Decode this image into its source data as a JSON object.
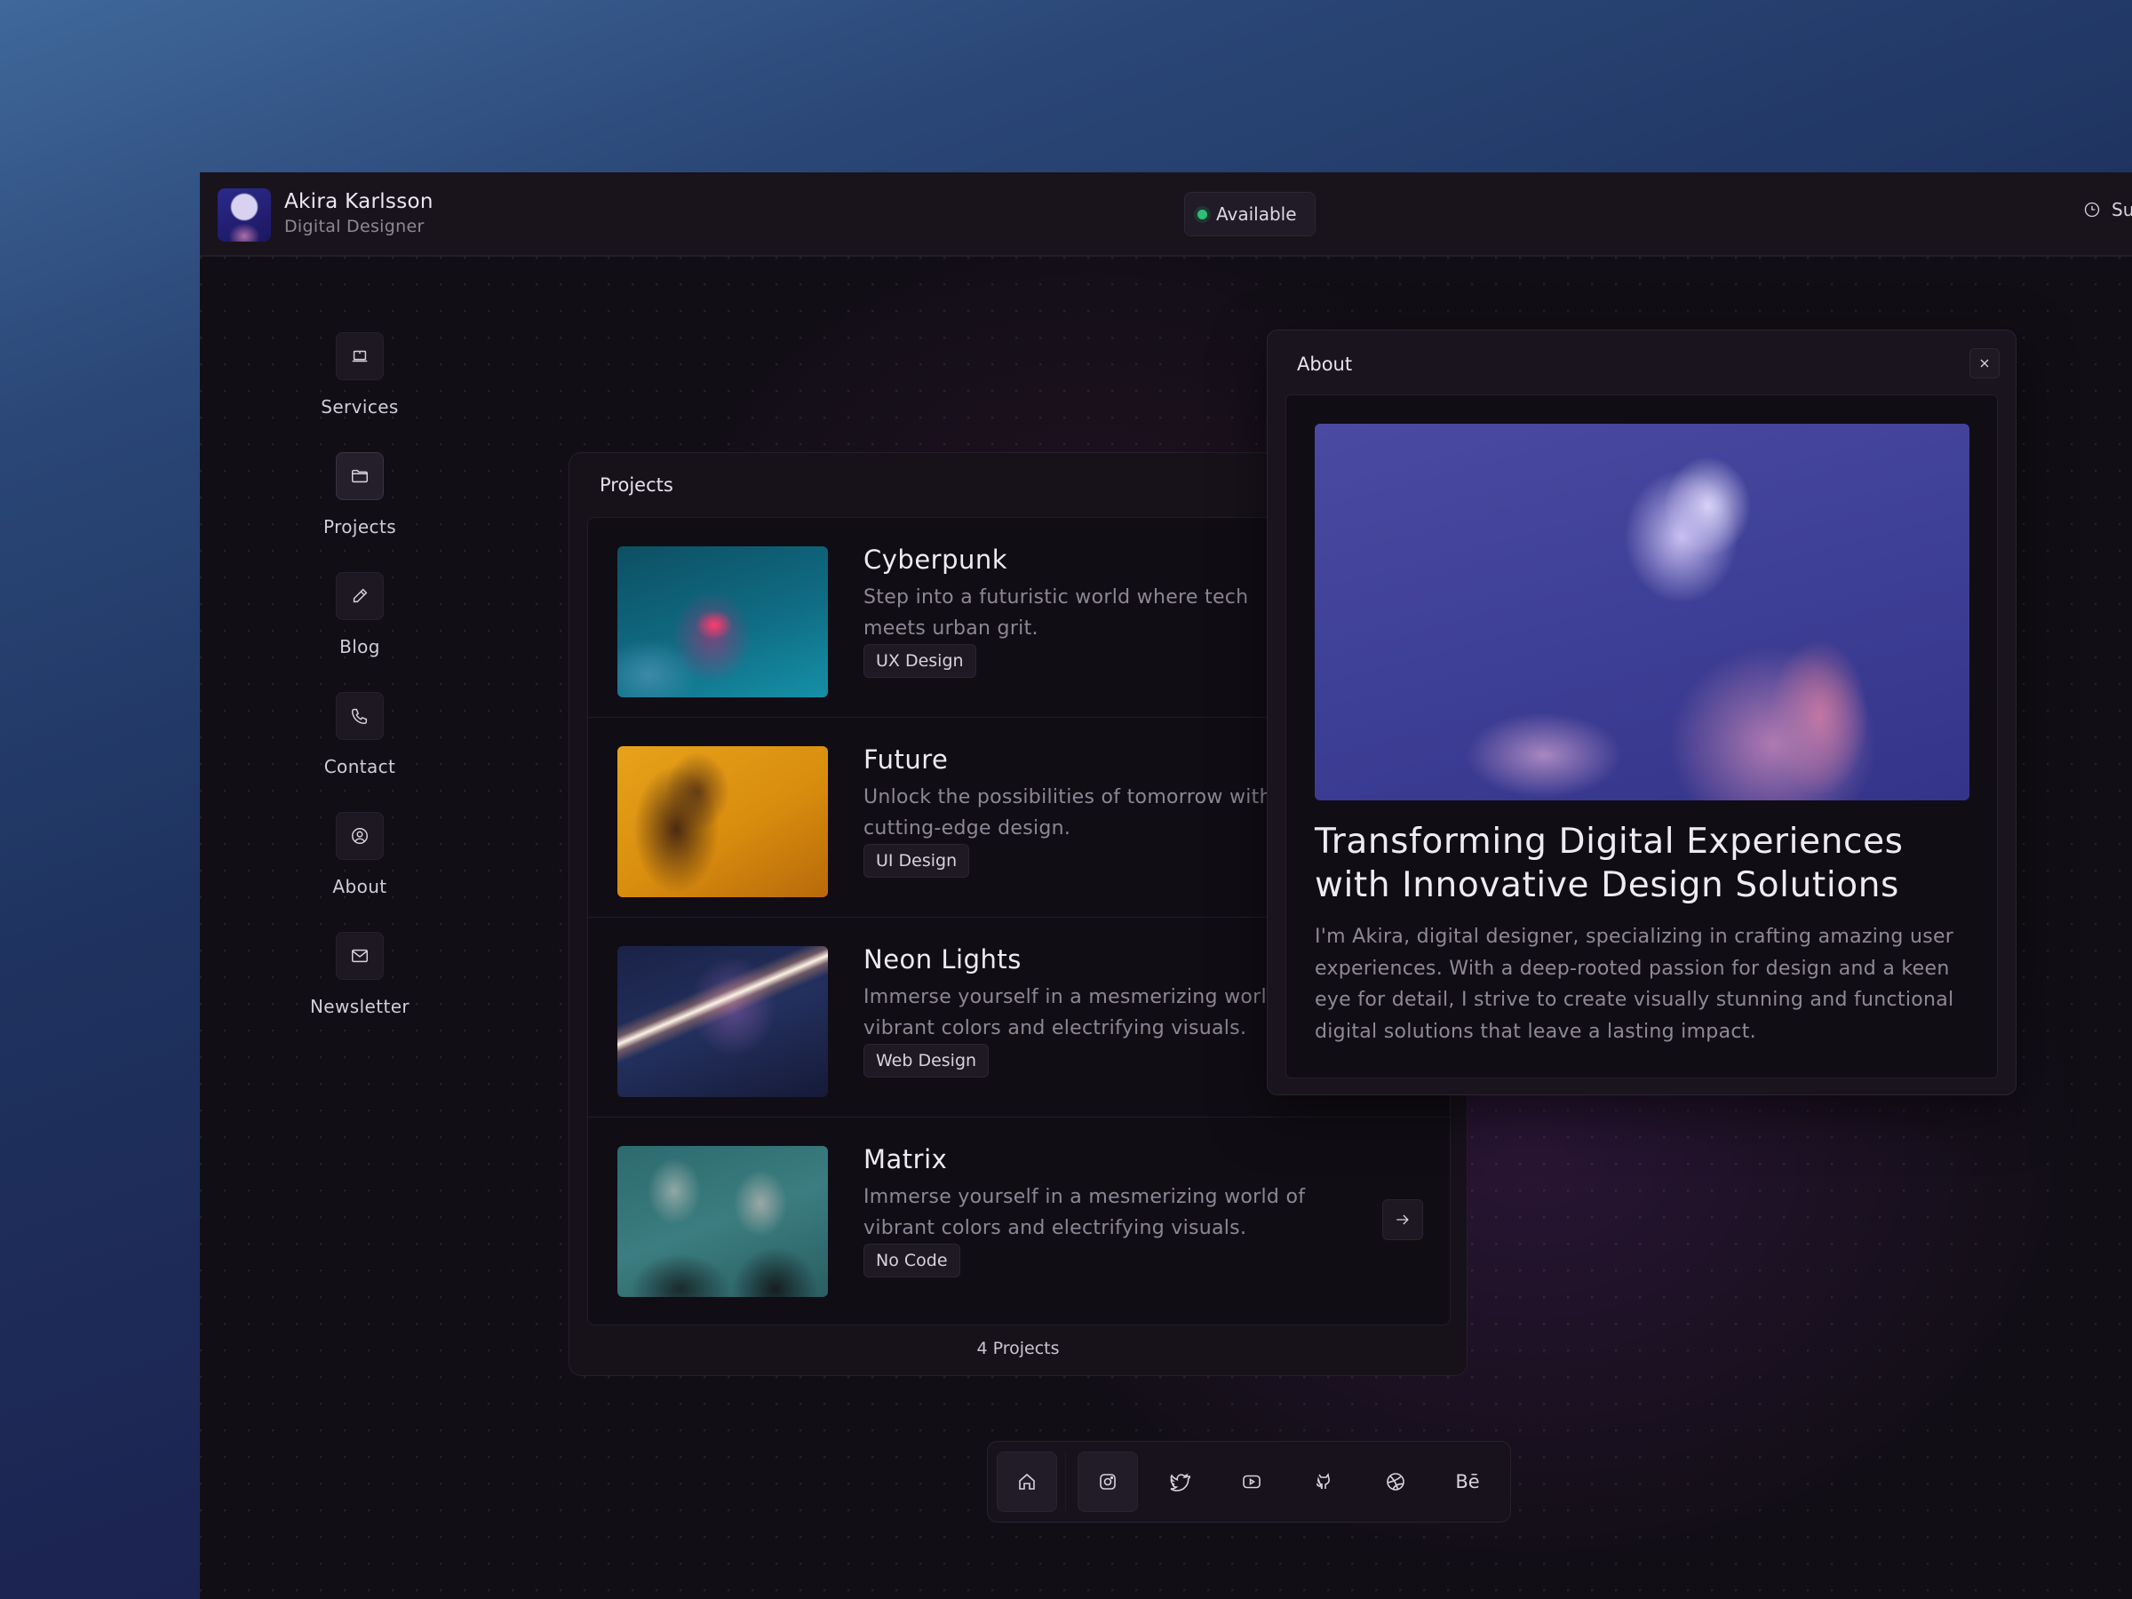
{
  "header": {
    "profile_name": "Akira Karlsson",
    "profile_role": "Digital Designer",
    "status_label": "Available",
    "status_color": "#2dbf73",
    "clock_text": "Su"
  },
  "sidebar": {
    "items": [
      {
        "label": "Services",
        "icon": "laptop-icon"
      },
      {
        "label": "Projects",
        "icon": "folder-icon",
        "active": true
      },
      {
        "label": "Blog",
        "icon": "pencil-icon"
      },
      {
        "label": "Contact",
        "icon": "phone-icon"
      },
      {
        "label": "About",
        "icon": "user-circle-icon"
      },
      {
        "label": "Newsletter",
        "icon": "mail-icon"
      }
    ]
  },
  "projects": {
    "title": "Projects",
    "count_label": "4 Projects",
    "items": [
      {
        "name": "Cyberpunk",
        "description": "Step into a futuristic world where tech\nmeets urban grit.",
        "tag": "UX Design"
      },
      {
        "name": "Future",
        "description": "Unlock the possibilities of tomorrow with\ncutting-edge design.",
        "tag": "UI Design"
      },
      {
        "name": "Neon Lights",
        "description": "Immerse yourself in a mesmerizing world of\nvibrant colors and electrifying visuals.",
        "tag": "Web Design"
      },
      {
        "name": "Matrix",
        "description": "Immerse yourself in a mesmerizing world of\nvibrant colors and electrifying visuals.",
        "tag": "No Code"
      }
    ]
  },
  "about": {
    "title": "About",
    "heading": "Transforming Digital Experiences with Innovative Design Solutions",
    "body": "I'm Akira, digital designer, specializing in crafting amazing user experiences. With a deep-rooted passion for design and a keen eye for detail, I strive to create visually stunning and functional digital solutions that leave a lasting impact."
  },
  "dock": {
    "items": [
      {
        "icon": "home-icon"
      },
      {
        "icon": "instagram-icon"
      },
      {
        "icon": "twitter-icon"
      },
      {
        "icon": "youtube-icon"
      },
      {
        "icon": "github-icon"
      },
      {
        "icon": "dribbble-icon"
      },
      {
        "icon": "behance-icon",
        "text": "Bē"
      }
    ]
  }
}
